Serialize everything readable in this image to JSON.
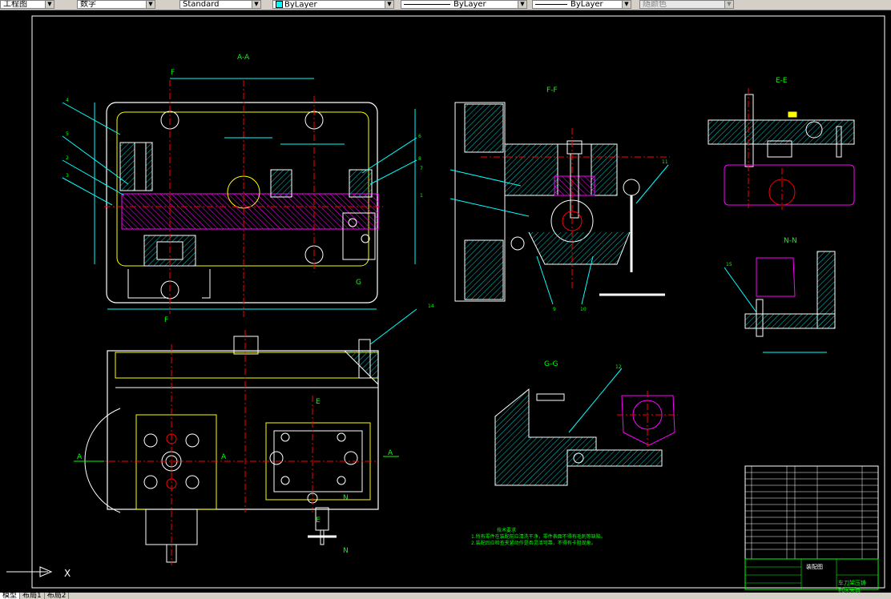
{
  "toolbar": {
    "drawing_name": "工程图",
    "text_style": "数字",
    "dim_style": "Standard",
    "layer": "ByLayer",
    "linetype": "ByLayer",
    "lineweight": "ByLayer",
    "plot_color": "随颜色"
  },
  "views": {
    "aa": "A-A",
    "ff": "F-F",
    "ee": "E-E",
    "nn": "N-N",
    "gg": "G-G"
  },
  "section_marks": {
    "f": "F",
    "g": "G",
    "a": "A",
    "e": "E",
    "n": "N"
  },
  "balloons": [
    "4",
    "5",
    "2",
    "3",
    "6",
    "8",
    "7",
    "11",
    "1",
    "9",
    "10",
    "14",
    "12",
    "15"
  ],
  "notes": {
    "title": "技术要求",
    "line1": "1.所有零件在装配前应清洗干净，零件表面不得有毛刺等缺陷。",
    "line2": "2.装配后应检查夹紧动作是否灵活可靠，不得有卡阻现象。"
  },
  "title_block": {
    "drawing_title": "装配图",
    "part_title_1": "车刀架压铸",
    "part_title_2": "机床夹具"
  },
  "command_line": "X",
  "tabs": [
    "模型",
    "布局1",
    "布局2"
  ]
}
